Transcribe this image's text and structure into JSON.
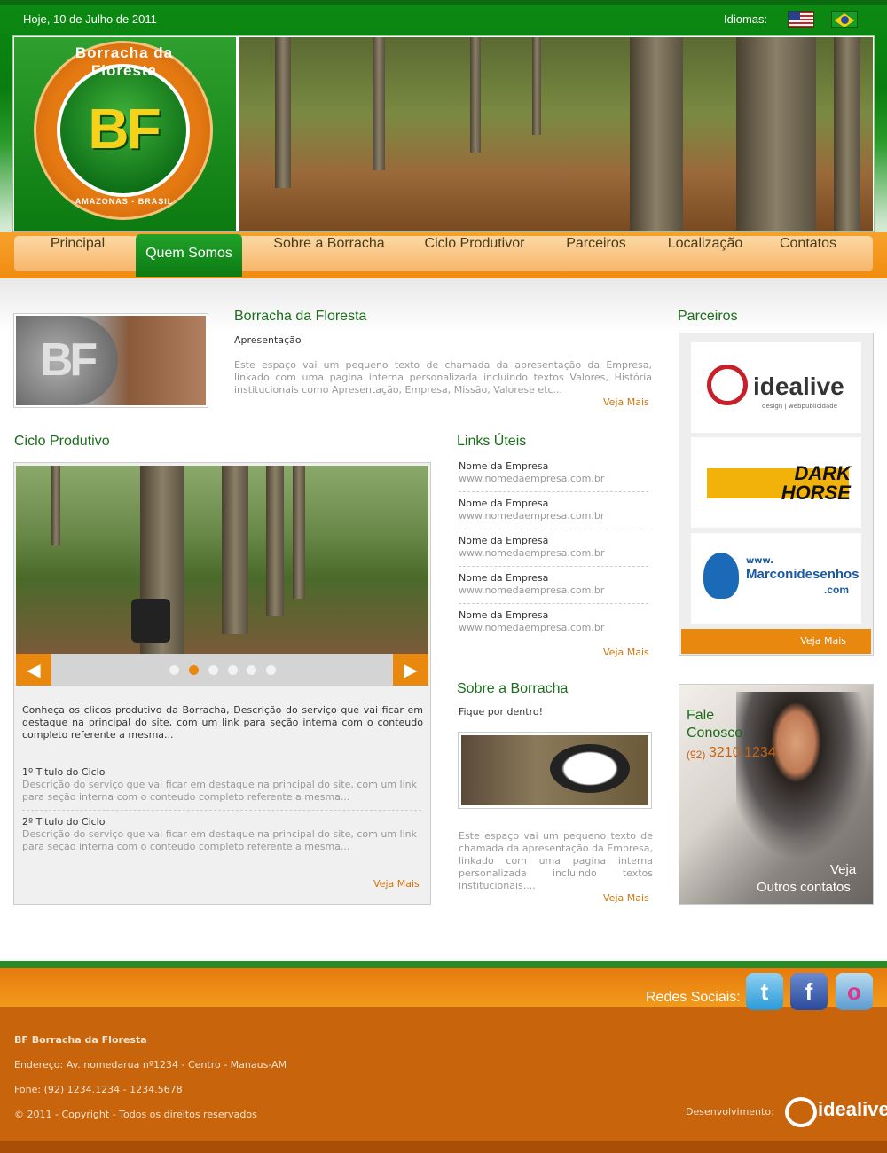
{
  "header": {
    "date": "Hoje, 10 de Julho de 2011",
    "languages_label": "Idiomas:",
    "logo": {
      "initials": "BF",
      "arc_top": "Borracha da Floresta",
      "arc_bottom": "AMAZONAS - BRASIL"
    }
  },
  "nav": {
    "items": [
      {
        "label": "Principal"
      },
      {
        "label": "Quem Somos"
      },
      {
        "label": "Sobre a Borracha"
      },
      {
        "label": "Ciclo Produtivor"
      },
      {
        "label": "Parceiros"
      },
      {
        "label": "Localização"
      },
      {
        "label": "Contatos"
      }
    ],
    "active": "Quem Somos"
  },
  "about": {
    "title": "Borracha da Floresta",
    "subtitle": "Apresentação",
    "text": "Este espaço vai um pequeno texto de chamada da apresentação da Empresa, linkado com uma pagina interna personalizada incluindo textos Valores, História institucionais como Apresentação, Empresa, Missão, Valorese etc...",
    "more": "Veja Mais"
  },
  "ciclo": {
    "title": "Ciclo Produtivo",
    "slider": {
      "prev": "◀",
      "next": "▶",
      "dots": 6,
      "active_dot": 2
    },
    "intro": "Conheça os clicos produtivo da Borracha, Descrição do serviço que vai ficar em destaque na principal do site, com um link para seção interna com o conteudo completo referente a mesma...",
    "items": [
      {
        "title": "1º Titulo do Ciclo",
        "text": "Descrição do serviço que vai ficar em destaque na principal do site, com um link para seção interna com o conteudo completo referente a mesma..."
      },
      {
        "title": "2º Titulo do Ciclo",
        "text": "Descrição do serviço que vai ficar em destaque na principal do site, com um link para seção interna com o conteudo completo referente a mesma..."
      }
    ],
    "more": "Veja Mais"
  },
  "links": {
    "title": "Links Úteis",
    "items": [
      {
        "name": "Nome da Empresa",
        "url": "www.nomedaempresa.com.br"
      },
      {
        "name": "Nome da Empresa",
        "url": "www.nomedaempresa.com.br"
      },
      {
        "name": "Nome da Empresa",
        "url": "www.nomedaempresa.com.br"
      },
      {
        "name": "Nome da Empresa",
        "url": "www.nomedaempresa.com.br"
      },
      {
        "name": "Nome da Empresa",
        "url": "www.nomedaempresa.com.br"
      }
    ],
    "more": "Veja Mais"
  },
  "borracha": {
    "title": "Sobre a Borracha",
    "subtitle": "Fique por dentro!",
    "text": "Este espaço vai um pequeno texto de chamada da apresentação da Empresa, linkado com uma pagina interna personalizada incluindo textos institucionais....",
    "more": "Veja Mais"
  },
  "parceiros": {
    "title": "Parceiros",
    "logos": [
      {
        "name": "idealive",
        "tagline": "design | webpublicidade"
      },
      {
        "name": "DARK HORSE",
        "line2": "HORSE"
      },
      {
        "name": "Marconidesenhos",
        "prefix": "www.",
        "suffix": ".com"
      }
    ],
    "more": "Veja Mais"
  },
  "fale": {
    "line1": "Fale",
    "line2": "Conosco",
    "phone_prefix": "(92)",
    "phone": "3210.1234",
    "veja": "Veja",
    "outros": "Outros contatos"
  },
  "footer": {
    "social_label": "Redes Sociais:",
    "company": "BF Borracha da Floresta",
    "address": "Endereço: Av. nomedarua nº1234 - Centro - Manaus-AM",
    "phone": "Fone: (92) 1234.1234 - 1234.5678",
    "copyright": "© 2011 - Copyright - Todos os direitos reservados",
    "dev_label": "Desenvolvimento:",
    "dev_brand": "idealive",
    "social": [
      "t",
      "f",
      "o"
    ]
  },
  "colors": {
    "green": "#0b8a12",
    "orange": "#e8880e",
    "footer": "#c8640c"
  }
}
